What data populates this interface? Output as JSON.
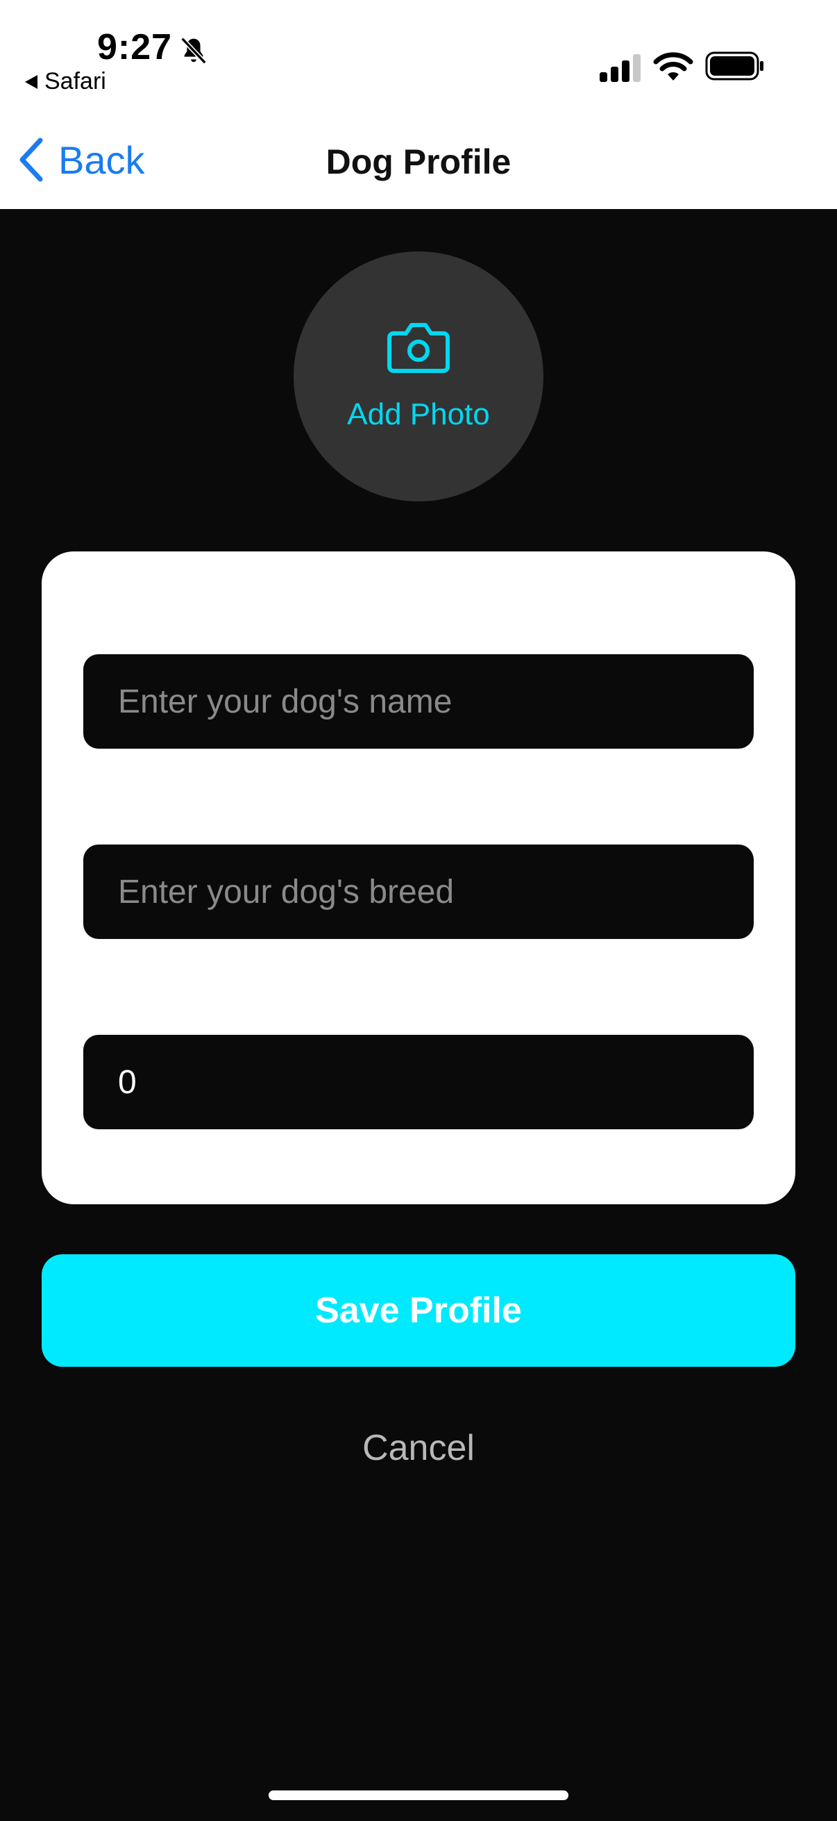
{
  "status_bar": {
    "time": "9:27",
    "back_app": "Safari",
    "icons": [
      "bell-slash-icon",
      "cellular-signal-icon",
      "wifi-icon",
      "battery-icon"
    ]
  },
  "nav": {
    "back_label": "Back",
    "title": "Dog Profile"
  },
  "photo": {
    "label": "Add Photo",
    "icon": "camera-icon"
  },
  "form": {
    "name_placeholder": "Enter your dog's name",
    "name_value": "",
    "breed_placeholder": "Enter your dog's breed",
    "breed_value": "",
    "age_value": "0"
  },
  "actions": {
    "save_label": "Save Profile",
    "cancel_label": "Cancel"
  },
  "colors": {
    "accent": "#00eaff",
    "accent_text": "#00d8f0",
    "link": "#1a7cf0",
    "background": "#0a0a0a",
    "card": "#ffffff"
  }
}
